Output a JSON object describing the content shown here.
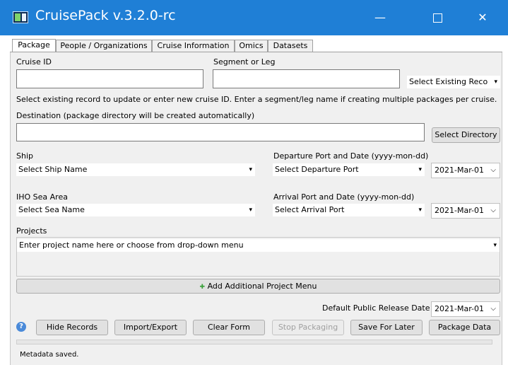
{
  "window": {
    "title": "CruisePack v.3.2.0-rc",
    "min_glyph": "—",
    "close_glyph": "✕"
  },
  "tabs": [
    {
      "label": "Package",
      "active": true
    },
    {
      "label": "People / Organizations",
      "active": false
    },
    {
      "label": "Cruise Information",
      "active": false
    },
    {
      "label": "Omics",
      "active": false
    },
    {
      "label": "Datasets",
      "active": false
    }
  ],
  "package": {
    "cruise_id_label": "Cruise ID",
    "cruise_id_value": "",
    "segment_label": "Segment or Leg",
    "segment_value": "",
    "existing_record_select": "Select Existing Reco",
    "hint_text": "Select existing record to update or enter new cruise ID. Enter a segment/leg name if creating multiple packages per cruise.",
    "destination_label": "Destination (package directory will be created automatically)",
    "destination_value": "",
    "select_directory_button": "Select Directory",
    "ship_label": "Ship",
    "ship_select": "Select Ship Name",
    "departure_label": "Departure Port and Date (yyyy-mon-dd)",
    "departure_port_select": "Select Departure Port",
    "departure_date": "2021-Mar-01",
    "iho_label": "IHO Sea Area",
    "iho_select": "Select Sea Name",
    "arrival_label": "Arrival Port and Date (yyyy-mon-dd)",
    "arrival_port_select": "Select Arrival Port",
    "arrival_date": "2021-Mar-01",
    "projects_label": "Projects",
    "project_select": "Enter project name here or choose from drop-down menu",
    "add_project_button": "Add Additional Project Menu",
    "release_label": "Default Public Release Date",
    "release_date": "2021-Mar-01"
  },
  "buttons": {
    "hide_records": "Hide Records",
    "import_export": "Import/Export",
    "clear_form": "Clear Form",
    "stop_packaging": "Stop Packaging",
    "save_for_later": "Save For Later",
    "package_data": "Package Data"
  },
  "icons": {
    "help": "help-icon",
    "add": "plus-icon",
    "dropdown": "chevron-down-icon"
  },
  "glyphs": {
    "dropdown_arrow": "▾",
    "date_chevron": "⌵",
    "plus": "✚",
    "help": "?"
  },
  "colors": {
    "titlebar": "#1f7fd6",
    "add_icon": "#3aa03a"
  },
  "status_text": "Metadata saved."
}
